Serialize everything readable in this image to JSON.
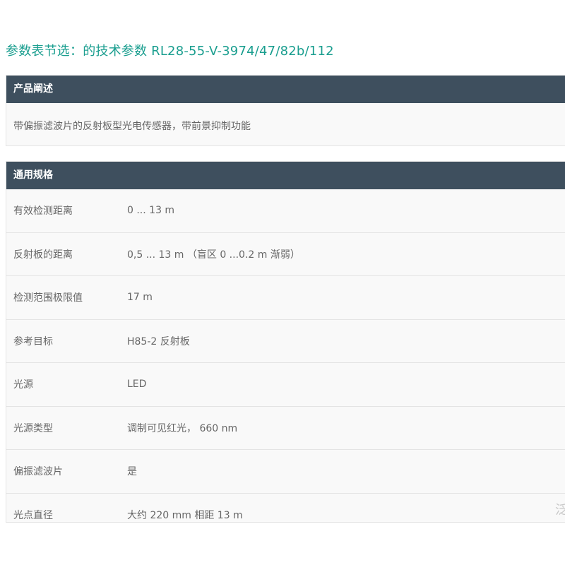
{
  "page": {
    "title": "参数表节选：的技术参数  RL28-55-V-3974/47/82b/112"
  },
  "description": {
    "header": "产品阐述",
    "text": "带偏振滤波片的反射板型光电传感器，带前景抑制功能"
  },
  "specs": {
    "header": "通用规格",
    "rows": [
      {
        "label": "有效检测距离",
        "value": "0 ... 13 m"
      },
      {
        "label": "反射板的距离",
        "value": "0,5 ... 13 m （盲区 0 ...0.2 m 渐弱）"
      },
      {
        "label": "检测范围极限值",
        "value": "17 m"
      },
      {
        "label": "参考目标",
        "value": "H85-2 反射板"
      },
      {
        "label": "光源",
        "value": "LED"
      },
      {
        "label": "光源类型",
        "value": "调制可见红光， 660 nm"
      },
      {
        "label": "偏振滤波片",
        "value": "是"
      },
      {
        "label": "光点直径",
        "value": "大约 220 mm 相距 13 m"
      }
    ]
  },
  "edge_fragment": "泛"
}
